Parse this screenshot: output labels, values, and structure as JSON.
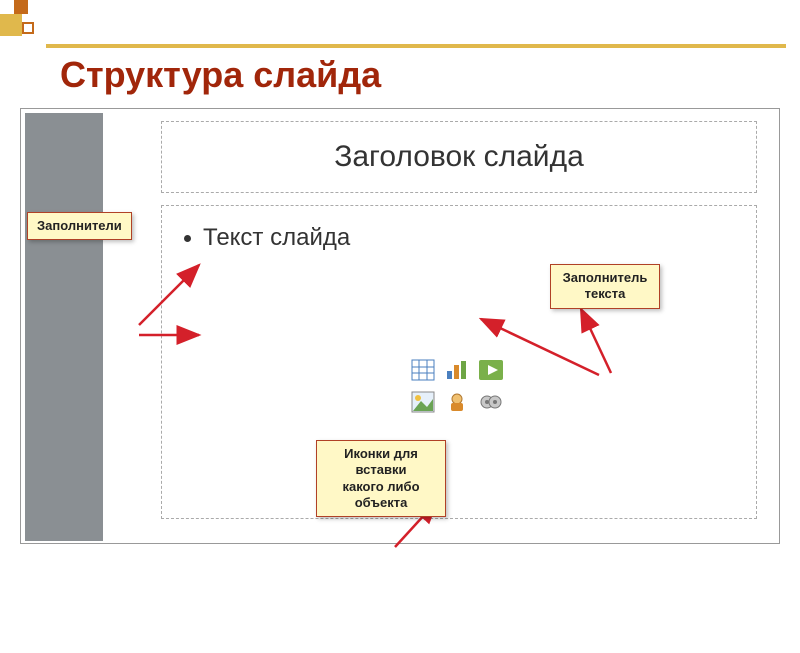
{
  "page_title": "Структура слайда",
  "slide": {
    "title_placeholder_text": "Заголовок слайда",
    "body_bullet_text": "Текст слайда"
  },
  "callouts": {
    "left": "Заполнители",
    "right": "Заполнитель\nтекста",
    "bottom": "Иконки для\nвставки\nкакого либо\nобъекта"
  },
  "content_icons": {
    "table": "table-icon",
    "chart": "chart-icon",
    "smartart": "smartart-icon",
    "picture": "picture-icon",
    "clipart": "clipart-icon",
    "media": "media-icon"
  },
  "colors": {
    "accent_title": "#a1260a",
    "accent_bar": "#e0b84c",
    "callout_bg": "#fff8c6",
    "callout_border": "#b04126"
  }
}
